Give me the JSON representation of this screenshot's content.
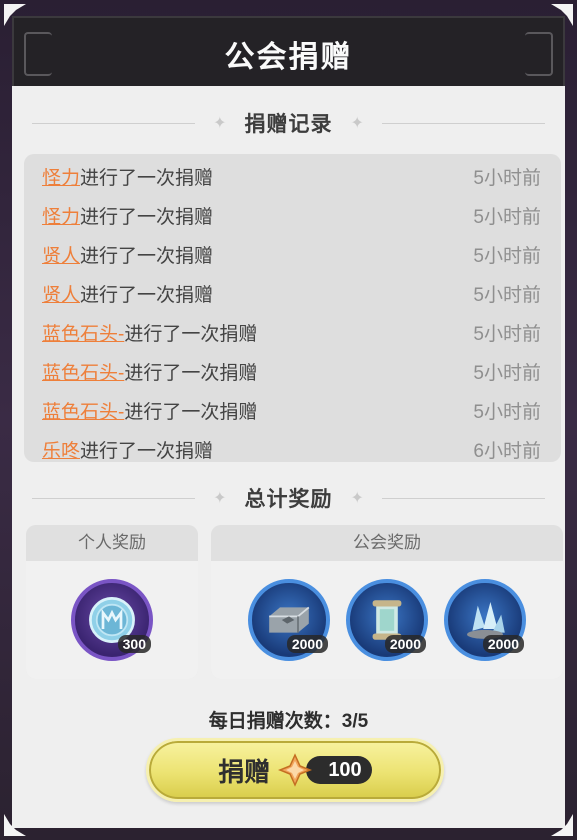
{
  "title": "公会捐赠",
  "donation_log": {
    "heading": "捐赠记录",
    "entries": [
      {
        "name": "怪力",
        "action": "进行了一次捐赠",
        "time": "5小时前"
      },
      {
        "name": "怪力",
        "action": "进行了一次捐赠",
        "time": "5小时前"
      },
      {
        "name": "贤人",
        "action": "进行了一次捐赠",
        "time": "5小时前"
      },
      {
        "name": "贤人",
        "action": "进行了一次捐赠",
        "time": "5小时前"
      },
      {
        "name": "蓝色石头-",
        "action": "进行了一次捐赠",
        "time": "5小时前"
      },
      {
        "name": "蓝色石头-",
        "action": "进行了一次捐赠",
        "time": "5小时前"
      },
      {
        "name": "蓝色石头-",
        "action": "进行了一次捐赠",
        "time": "5小时前"
      },
      {
        "name": "乐咚",
        "action": "进行了一次捐赠",
        "time": "6小时前"
      }
    ]
  },
  "rewards": {
    "heading": "总计奖励",
    "personal": {
      "label": "个人奖励",
      "items": [
        {
          "icon": "guild-coin-icon",
          "qty": "300"
        }
      ]
    },
    "guild": {
      "label": "公会奖励",
      "items": [
        {
          "icon": "iron-ingot-icon",
          "qty": "2000"
        },
        {
          "icon": "scroll-relic-icon",
          "qty": "2000"
        },
        {
          "icon": "crystal-ore-icon",
          "qty": "2000"
        }
      ]
    }
  },
  "daily": {
    "label": "每日捐赠次数：",
    "count": "3/5"
  },
  "donate_button": {
    "label": "捐赠",
    "cost": "100",
    "currency_icon": "gem-star-icon"
  },
  "colors": {
    "accent_name": "#ee7f3a",
    "button_yellow": "#ece372",
    "header_dark": "#242226"
  }
}
